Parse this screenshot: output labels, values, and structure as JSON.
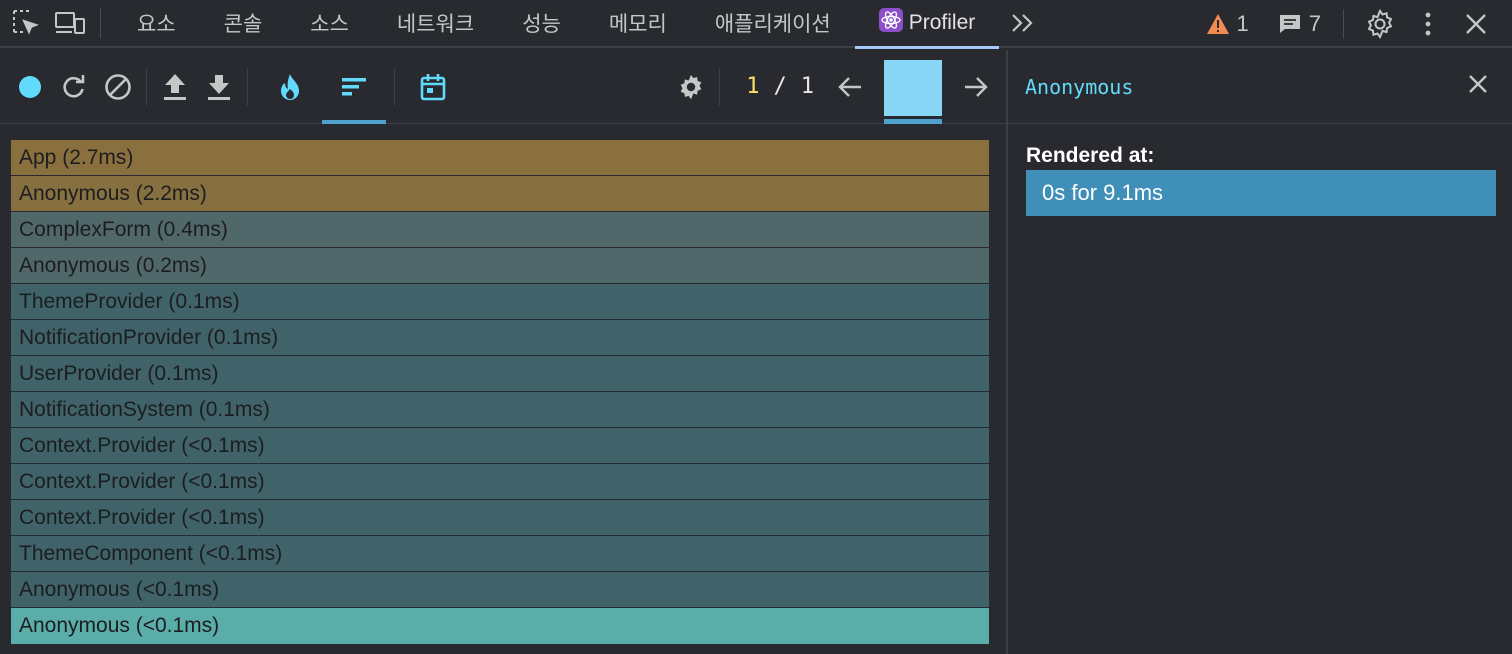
{
  "tabbar": {
    "tabs": [
      {
        "label": "요소",
        "name": "tab-elements"
      },
      {
        "label": "콘솔",
        "name": "tab-console"
      },
      {
        "label": "소스",
        "name": "tab-sources"
      },
      {
        "label": "네트워크",
        "name": "tab-network"
      },
      {
        "label": "성능",
        "name": "tab-performance"
      },
      {
        "label": "메모리",
        "name": "tab-memory"
      },
      {
        "label": "애플리케이션",
        "name": "tab-application"
      }
    ],
    "active_tab": "Profiler",
    "more_label": "»",
    "warnings_count": "1",
    "messages_count": "7"
  },
  "profiler": {
    "commit_index": "1",
    "commit_separator": "/",
    "commit_total": "1"
  },
  "flame": {
    "rows": [
      {
        "label": "App (2.7ms)",
        "color": "#8a703f"
      },
      {
        "label": "Anonymous (2.2ms)",
        "color": "#87703f"
      },
      {
        "label": "ComplexForm (0.4ms)",
        "color": "#51686a"
      },
      {
        "label": "Anonymous (0.2ms)",
        "color": "#51686a"
      },
      {
        "label": "ThemeProvider (0.1ms)",
        "color": "#3f6368"
      },
      {
        "label": "NotificationProvider (0.1ms)",
        "color": "#3f6368"
      },
      {
        "label": "UserProvider (0.1ms)",
        "color": "#3f6368"
      },
      {
        "label": "NotificationSystem (0.1ms)",
        "color": "#3f6368"
      },
      {
        "label": "Context.Provider (<0.1ms)",
        "color": "#3f6368"
      },
      {
        "label": "Context.Provider (<0.1ms)",
        "color": "#3f6368"
      },
      {
        "label": "Context.Provider (<0.1ms)",
        "color": "#3f6368"
      },
      {
        "label": "ThemeComponent (<0.1ms)",
        "color": "#3f6368"
      },
      {
        "label": "Anonymous (<0.1ms)",
        "color": "#3f6368"
      },
      {
        "label": "Anonymous (<0.1ms)",
        "color": "#5aada8"
      }
    ]
  },
  "details": {
    "component_name": "Anonymous",
    "rendered_at_label": "Rendered at:",
    "rendered_at_items": [
      "0s for 9.1ms"
    ]
  },
  "colors": {
    "accent_cyan": "#61dafb",
    "commit_bar": "#87d6f5",
    "selected_render": "#3f8fb8",
    "warning": "#f28b54",
    "record": "#61dafb"
  }
}
